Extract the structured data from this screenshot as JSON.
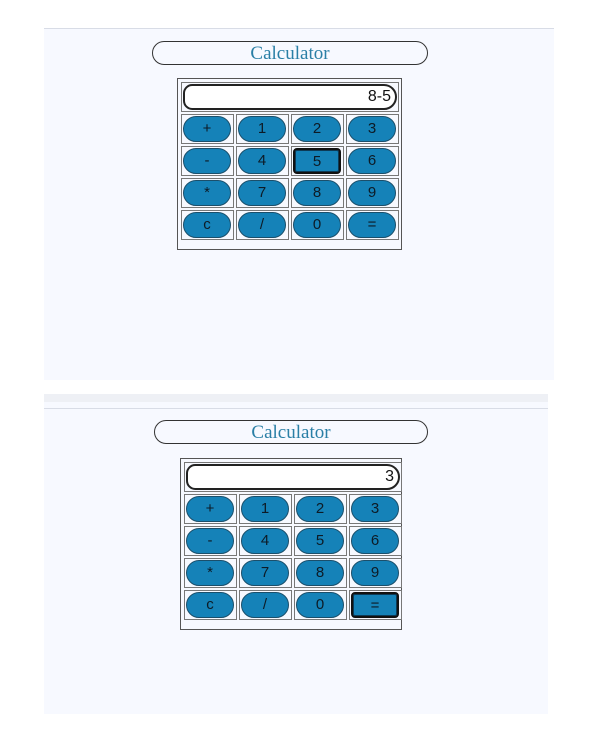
{
  "screens": [
    {
      "title": "Calculator",
      "display": "8-5",
      "active_key": "5"
    },
    {
      "title": "Calculator",
      "display": "3",
      "active_key": "="
    }
  ],
  "keys": [
    [
      "+",
      "1",
      "2",
      "3"
    ],
    [
      "-",
      "4",
      "5",
      "6"
    ],
    [
      "*",
      "7",
      "8",
      "9"
    ],
    [
      "c",
      "/",
      "0",
      "="
    ]
  ],
  "colors": {
    "title": "#2a7fa6",
    "key_fill": "#1582b8",
    "panel_bg": "#f7f9ff"
  }
}
